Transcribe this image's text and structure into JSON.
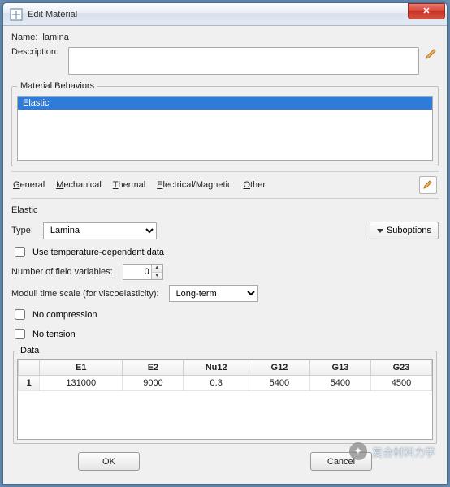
{
  "window": {
    "title": "Edit Material"
  },
  "name": {
    "label": "Name:",
    "value": "lamina"
  },
  "description": {
    "label": "Description:",
    "value": ""
  },
  "behaviors": {
    "legend": "Material Behaviors",
    "items": [
      "Elastic"
    ]
  },
  "menus": {
    "general": "General",
    "mechanical": "Mechanical",
    "thermal": "Thermal",
    "electrical": "Electrical/Magnetic",
    "other": "Other"
  },
  "elastic": {
    "heading": "Elastic",
    "type_label": "Type:",
    "type_value": "Lamina",
    "suboptions": "Suboptions",
    "use_temp": "Use temperature-dependent data",
    "nfv_label": "Number of field variables:",
    "nfv_value": "0",
    "moduli_label": "Moduli time scale (for viscoelasticity):",
    "moduli_value": "Long-term",
    "no_compression": "No compression",
    "no_tension": "No tension"
  },
  "data": {
    "legend": "Data",
    "columns": [
      "E1",
      "E2",
      "Nu12",
      "G12",
      "G13",
      "G23"
    ],
    "rows": [
      {
        "n": "1",
        "cells": [
          "131000",
          "9000",
          "0.3",
          "5400",
          "5400",
          "4500"
        ]
      }
    ]
  },
  "buttons": {
    "ok": "OK",
    "cancel": "Cancel"
  },
  "watermark": {
    "text": "复合材料力学"
  }
}
